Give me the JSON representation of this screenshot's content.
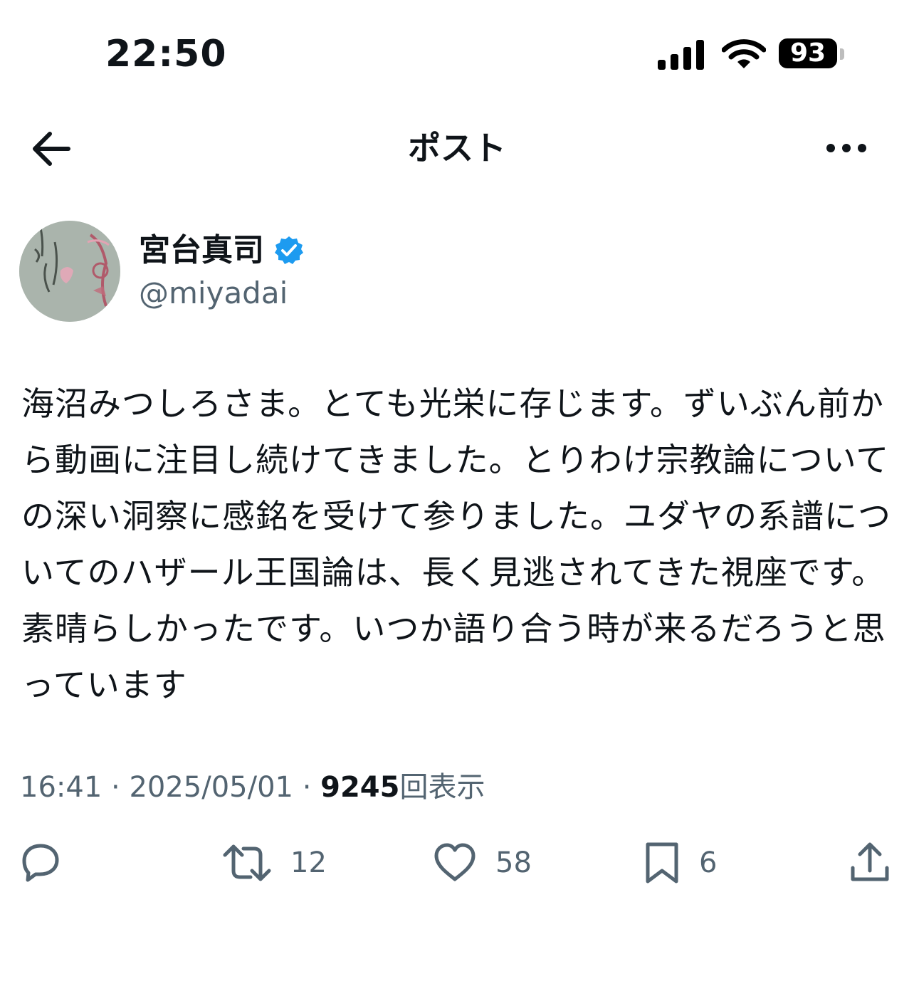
{
  "status_bar": {
    "time": "22:50",
    "battery": "93",
    "icons": [
      "signal-icon",
      "wifi-icon",
      "battery-icon"
    ]
  },
  "header": {
    "title": "ポスト",
    "back_icon": "arrow-left-icon",
    "more_icon": "more-horizontal-icon"
  },
  "post": {
    "author": {
      "display_name": "宮台真司",
      "handle": "@miyadai",
      "verified": true,
      "verified_color": "#1d9bf0"
    },
    "text": "海沼みつしろさま。とても光栄に存じます。ずいぶん前から動画に注目し続けてきました。とりわけ宗教論についての深い洞察に感銘を受けて参りました。ユダヤの系譜についてのハザール王国論は、長く見逃されてきた視座です。素晴らしかったです。いつか語り合う時が来るだろうと思っています",
    "time": "16:41",
    "separator": "·",
    "date": "2025/05/01",
    "views": "9245",
    "views_label": "回表示"
  },
  "actions": {
    "reply": {
      "icon": "reply-icon",
      "count": ""
    },
    "retweet": {
      "icon": "retweet-icon",
      "count": "12"
    },
    "like": {
      "icon": "heart-icon",
      "count": "58"
    },
    "bookmark": {
      "icon": "bookmark-icon",
      "count": "6"
    },
    "share": {
      "icon": "share-icon",
      "count": ""
    }
  },
  "colors": {
    "text": "#0f1419",
    "secondary": "#536471",
    "background": "#ffffff"
  }
}
